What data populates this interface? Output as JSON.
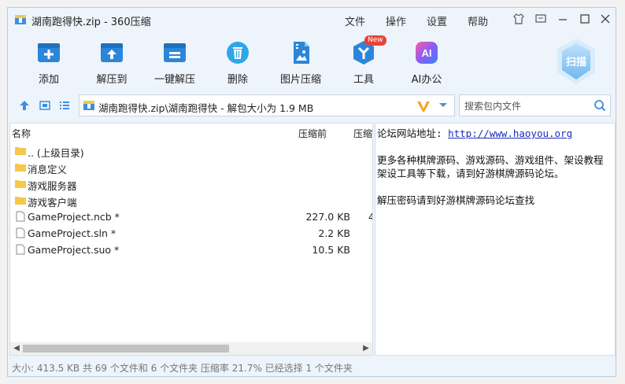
{
  "window": {
    "title": "湖南跑得快.zip - 360压缩",
    "menu": [
      "文件",
      "操作",
      "设置",
      "帮助"
    ]
  },
  "toolbar": {
    "buttons": [
      {
        "label": "添加",
        "icon": "add-icon"
      },
      {
        "label": "解压到",
        "icon": "extract-to-icon"
      },
      {
        "label": "一键解压",
        "icon": "one-click-extract-icon"
      },
      {
        "label": "删除",
        "icon": "trash-icon"
      },
      {
        "label": "图片压缩",
        "icon": "image-compress-icon"
      },
      {
        "label": "工具",
        "icon": "tools-icon",
        "badge": "New"
      },
      {
        "label": "AI办公",
        "icon": "ai-icon",
        "icon_text": "AI"
      }
    ],
    "scan_label": "扫描"
  },
  "address": {
    "path": "湖南跑得快.zip\\湖南跑得快 - 解包大小为 1.9 MB"
  },
  "search": {
    "placeholder": "搜索包内文件"
  },
  "file_list": {
    "columns": {
      "name": "名称",
      "size": "压缩前",
      "ratio": "压缩"
    },
    "rows": [
      {
        "name": ".. (上级目录)",
        "type": "folder",
        "size": "",
        "ratio": ""
      },
      {
        "name": "消息定义",
        "type": "folder",
        "size": "",
        "ratio": ""
      },
      {
        "name": "游戏服务器",
        "type": "folder",
        "size": "",
        "ratio": ""
      },
      {
        "name": "游戏客户端",
        "type": "folder",
        "size": "",
        "ratio": ""
      },
      {
        "name": "GameProject.ncb *",
        "type": "file",
        "size": "227.0 KB",
        "ratio": "4"
      },
      {
        "name": "GameProject.sln *",
        "type": "file",
        "size": "2.2 KB",
        "ratio": ""
      },
      {
        "name": "GameProject.suo *",
        "type": "file",
        "size": "10.5 KB",
        "ratio": ""
      }
    ]
  },
  "info": {
    "forum_label": "论坛网站地址:",
    "forum_url": "http://www.haoyou.org",
    "line2": "更多各种棋牌源码、游戏源码、游戏组件、架设教程",
    "line3": "架设工具等下载，请到好游棋牌源码论坛。",
    "line4": "解压密码请到好游棋牌源码论坛查找"
  },
  "status": {
    "text": "大小: 413.5 KB 共 69 个文件和 6 个文件夹 压缩率 21.7% 已经选择 1 个文件夹"
  },
  "colors": {
    "accent_blue": "#2b86d9",
    "folder_yellow": "#f5c84c",
    "link_blue": "#1a2cc0"
  }
}
